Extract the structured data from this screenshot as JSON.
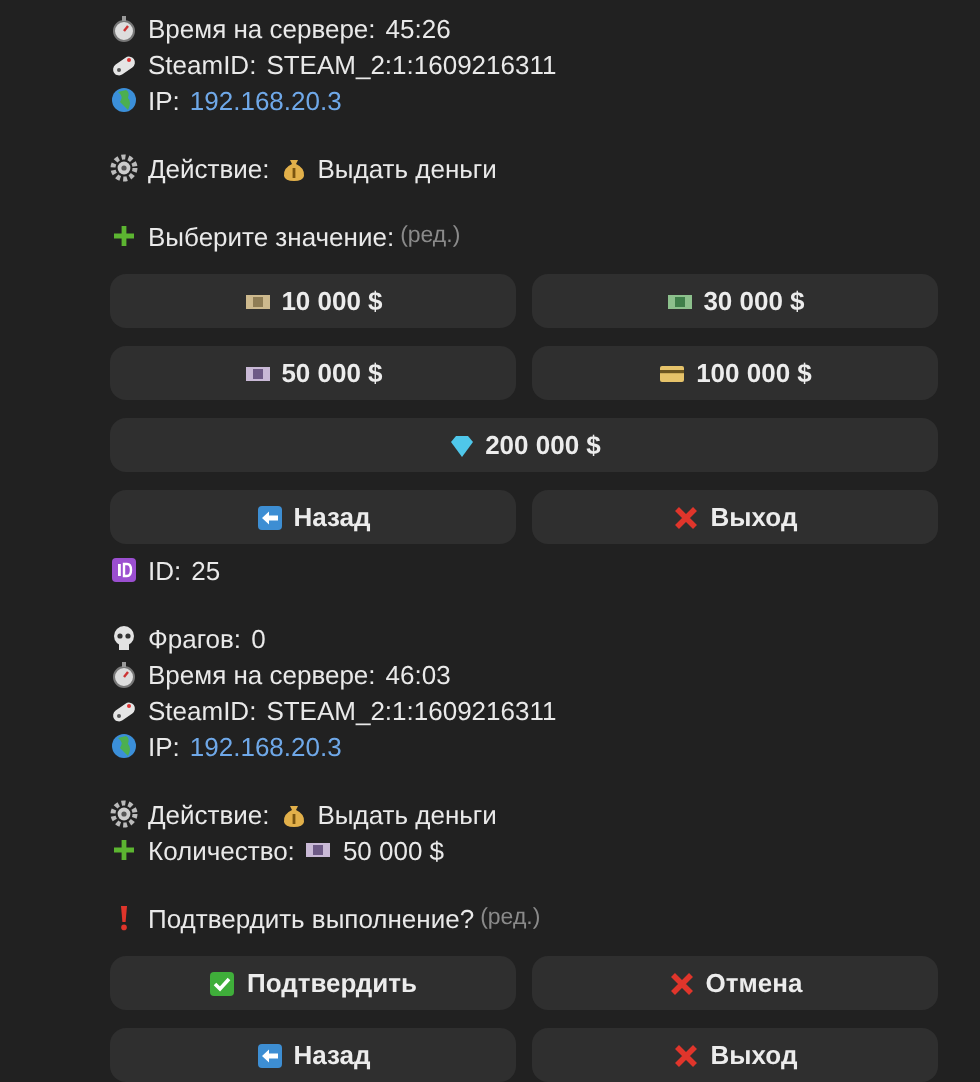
{
  "messages": [
    {
      "blocks": [
        [
          {
            "kind": "time",
            "label": "Время на сервере:",
            "value": "45:26"
          },
          {
            "kind": "steamid",
            "label": "SteamID:",
            "value": "STEAM_2:1:1609216311"
          },
          {
            "kind": "ip",
            "label": "IP:",
            "value": "192.168.20.3"
          }
        ],
        [
          {
            "kind": "action",
            "label": "Действие:",
            "value": "Выдать деньги"
          }
        ],
        [
          {
            "kind": "choose",
            "label": "Выберите значение:",
            "edited": "(ред.)"
          }
        ]
      ],
      "keyboard": [
        [
          {
            "kind": "amount",
            "label": "10 000 $"
          },
          {
            "kind": "amount",
            "label": "30 000 $"
          }
        ],
        [
          {
            "kind": "amount",
            "label": "50 000 $"
          },
          {
            "kind": "amount",
            "label": "100 000 $"
          }
        ],
        [
          {
            "kind": "amount",
            "label": "200 000 $"
          }
        ],
        [
          {
            "kind": "back",
            "label": "Назад"
          },
          {
            "kind": "exit",
            "label": "Выход"
          }
        ]
      ]
    },
    {
      "blocks": [
        [
          {
            "kind": "id",
            "label": "ID:",
            "value": "25"
          }
        ],
        [
          {
            "kind": "frags",
            "label": "Фрагов:",
            "value": "0"
          },
          {
            "kind": "time",
            "label": "Время на сервере:",
            "value": "46:03"
          },
          {
            "kind": "steamid",
            "label": "SteamID:",
            "value": "STEAM_2:1:1609216311"
          },
          {
            "kind": "ip",
            "label": "IP:",
            "value": "192.168.20.3"
          }
        ],
        [
          {
            "kind": "action",
            "label": "Действие:",
            "value": "Выдать деньги"
          },
          {
            "kind": "amount",
            "label": "Количество:",
            "value": "50 000 $"
          }
        ],
        [
          {
            "kind": "confirm",
            "label": "Подтвердить выполнение?",
            "edited": "(ред.)"
          }
        ]
      ],
      "keyboard": [
        [
          {
            "kind": "confirm",
            "label": "Подтвердить"
          },
          {
            "kind": "cancel",
            "label": "Отмена"
          }
        ],
        [
          {
            "kind": "back",
            "label": "Назад"
          },
          {
            "kind": "exit",
            "label": "Выход"
          }
        ]
      ]
    }
  ]
}
